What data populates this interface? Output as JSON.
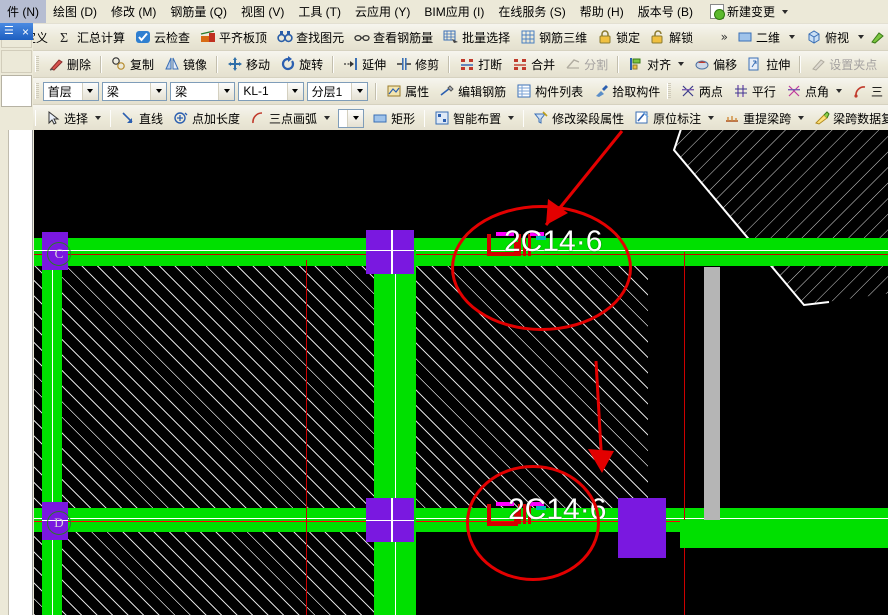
{
  "menubar": {
    "items": [
      {
        "label": "件 (N)",
        "name": "menu-file"
      },
      {
        "label": "绘图 (D)",
        "name": "menu-draw"
      },
      {
        "label": "修改 (M)",
        "name": "menu-modify"
      },
      {
        "label": "钢筋量 (Q)",
        "name": "menu-rebar-quantity"
      },
      {
        "label": "视图 (V)",
        "name": "menu-view"
      },
      {
        "label": "工具 (T)",
        "name": "menu-tools"
      },
      {
        "label": "云应用 (Y)",
        "name": "menu-cloud-apps"
      },
      {
        "label": "BIM应用 (I)",
        "name": "menu-bim-apps"
      },
      {
        "label": "在线服务 (S)",
        "name": "menu-online-service"
      },
      {
        "label": "帮助 (H)",
        "name": "menu-help"
      },
      {
        "label": "版本号 (B)",
        "name": "menu-version"
      }
    ],
    "new_change": "新建变更"
  },
  "toolbar1": {
    "buttons": [
      {
        "label": "定义",
        "icon": "define-icon"
      },
      {
        "label": "汇总计算",
        "icon": "sigma-icon"
      },
      {
        "label": "云检查",
        "icon": "cloud-check-icon"
      },
      {
        "label": "平齐板顶",
        "icon": "align-slab-top-icon"
      },
      {
        "label": "查找图元",
        "icon": "binoculars-icon"
      },
      {
        "label": "查看钢筋量",
        "icon": "glasses-icon"
      },
      {
        "label": "批量选择",
        "icon": "batch-select-icon"
      },
      {
        "label": "钢筋三维",
        "icon": "rebar-3d-icon"
      },
      {
        "label": "锁定",
        "icon": "lock-icon"
      },
      {
        "label": "解锁",
        "icon": "unlock-icon"
      }
    ],
    "overflow": "»",
    "view_mode": "二维",
    "view_angle": "俯视"
  },
  "toolbar2": {
    "panel_pin": "pin-icon",
    "panel_close": "×",
    "buttons": [
      {
        "label": "删除",
        "icon": "delete-icon",
        "disabled": false
      },
      {
        "label": "复制",
        "icon": "copy-icon",
        "disabled": false
      },
      {
        "label": "镜像",
        "icon": "mirror-icon",
        "disabled": false
      },
      {
        "label": "移动",
        "icon": "move-icon",
        "disabled": false
      },
      {
        "label": "旋转",
        "icon": "rotate-icon",
        "disabled": false
      },
      {
        "label": "延伸",
        "icon": "extend-icon",
        "disabled": false
      },
      {
        "label": "修剪",
        "icon": "trim-icon",
        "disabled": false
      },
      {
        "label": "打断",
        "icon": "break-icon",
        "disabled": false
      },
      {
        "label": "合并",
        "icon": "merge-icon",
        "disabled": false
      },
      {
        "label": "分割",
        "icon": "split-icon",
        "disabled": true
      },
      {
        "label": "对齐",
        "icon": "align-icon",
        "disabled": false
      },
      {
        "label": "偏移",
        "icon": "offset-icon",
        "disabled": false
      },
      {
        "label": "拉伸",
        "icon": "stretch-icon",
        "disabled": false
      },
      {
        "label": "设置夹点",
        "icon": "set-grip-icon",
        "disabled": true
      }
    ]
  },
  "toolbar3": {
    "combos": [
      {
        "value": "首层",
        "name": "floor-select"
      },
      {
        "value": "梁",
        "name": "category-select"
      },
      {
        "value": "梁",
        "name": "subcategory-select"
      },
      {
        "value": "KL-1",
        "name": "component-select"
      },
      {
        "value": "分层1",
        "name": "layer-select"
      }
    ],
    "buttons": [
      {
        "label": "属性",
        "icon": "property-icon"
      },
      {
        "label": "编辑钢筋",
        "icon": "edit-rebar-icon"
      },
      {
        "label": "构件列表",
        "icon": "component-list-icon"
      },
      {
        "label": "拾取构件",
        "icon": "pick-component-icon"
      },
      {
        "label": "两点",
        "icon": "two-point-icon"
      },
      {
        "label": "平行",
        "icon": "parallel-icon"
      },
      {
        "label": "点角",
        "icon": "point-angle-icon"
      },
      {
        "label": "三",
        "icon": "three-icon"
      }
    ]
  },
  "toolbar4": {
    "buttons": [
      {
        "label": "选择",
        "icon": "cursor-icon",
        "dropdown": true
      },
      {
        "label": "直线",
        "icon": "line-icon",
        "dropdown": false
      },
      {
        "label": "点加长度",
        "icon": "point-length-icon",
        "dropdown": false
      },
      {
        "label": "三点画弧",
        "icon": "three-point-arc-icon",
        "dropdown": true
      },
      {
        "label": "矩形",
        "icon": "rectangle-icon",
        "dropdown": false
      },
      {
        "label": "智能布置",
        "icon": "smart-layout-icon",
        "dropdown": true
      },
      {
        "label": "修改梁段属性",
        "icon": "modify-beam-segment-icon",
        "dropdown": false
      },
      {
        "label": "原位标注",
        "icon": "in-situ-label-icon",
        "dropdown": true
      },
      {
        "label": "重提梁跨",
        "icon": "re-extract-span-icon",
        "dropdown": true
      },
      {
        "label": "梁跨数据复",
        "icon": "span-data-copy-icon",
        "dropdown": false
      }
    ],
    "empty_combo": ""
  },
  "canvas": {
    "background_color": "#000000",
    "beam_color": "#00e000",
    "column_color": "#7a18e0",
    "axis_color": "#cc0000",
    "annotation_color": "#e30000",
    "axis_labels": [
      {
        "text": "C",
        "name": "grid-axis-label-c"
      },
      {
        "text": "D",
        "name": "grid-axis-label-d"
      }
    ],
    "annotations": [
      {
        "text": "2C14·6",
        "name": "rebar-annotation-upper"
      },
      {
        "text": "2C14·6",
        "name": "rebar-annotation-lower"
      }
    ]
  }
}
